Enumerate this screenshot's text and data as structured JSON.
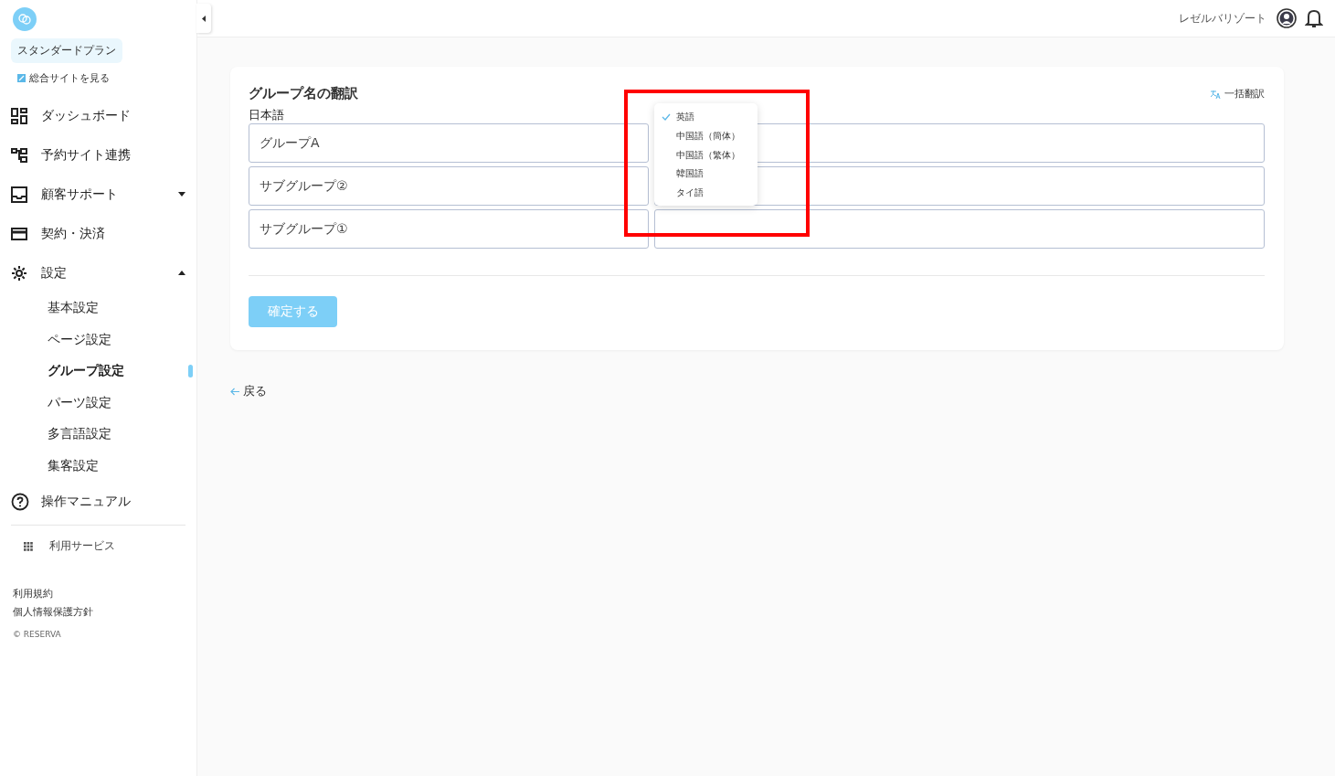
{
  "sidebar": {
    "plan": "スタンダードプラン",
    "site_link": "総合サイトを見る",
    "items": [
      {
        "label": "ダッシュボード",
        "kind": "dashboard"
      },
      {
        "label": "予約サイト連携",
        "kind": "link"
      },
      {
        "label": "顧客サポート",
        "kind": "inbox",
        "expanded": false
      },
      {
        "label": "契約・決済",
        "kind": "card"
      },
      {
        "label": "設定",
        "kind": "gear",
        "expanded": true,
        "children": [
          {
            "label": "基本設定",
            "selected": false
          },
          {
            "label": "ページ設定",
            "selected": false
          },
          {
            "label": "グループ設定",
            "selected": true
          },
          {
            "label": "パーツ設定",
            "selected": false
          },
          {
            "label": "多言語設定",
            "selected": false
          },
          {
            "label": "集客設定",
            "selected": false
          }
        ]
      },
      {
        "label": "操作マニュアル",
        "kind": "help"
      }
    ],
    "services": "利用サービス",
    "footer_links": [
      "利用規約",
      "個人情報保護方針"
    ],
    "copyright": "© RESERVA"
  },
  "header": {
    "user": "レゼルバリゾート"
  },
  "card": {
    "title": "グループ名の翻訳",
    "bulk_translate": "一括翻訳",
    "source_label": "日本語",
    "rows": [
      {
        "source": "グループA"
      },
      {
        "source": "サブグループ②"
      },
      {
        "source": "サブグループ①"
      }
    ],
    "language_menu": [
      {
        "label": "英語",
        "selected": true
      },
      {
        "label": "中国語（簡体）",
        "selected": false
      },
      {
        "label": "中国語（繁体）",
        "selected": false
      },
      {
        "label": "韓国語",
        "selected": false
      },
      {
        "label": "タイ語",
        "selected": false
      }
    ],
    "confirm": "確定する",
    "confirm_disabled": true
  },
  "back": "戻る",
  "annotation": {
    "highlight": true
  }
}
